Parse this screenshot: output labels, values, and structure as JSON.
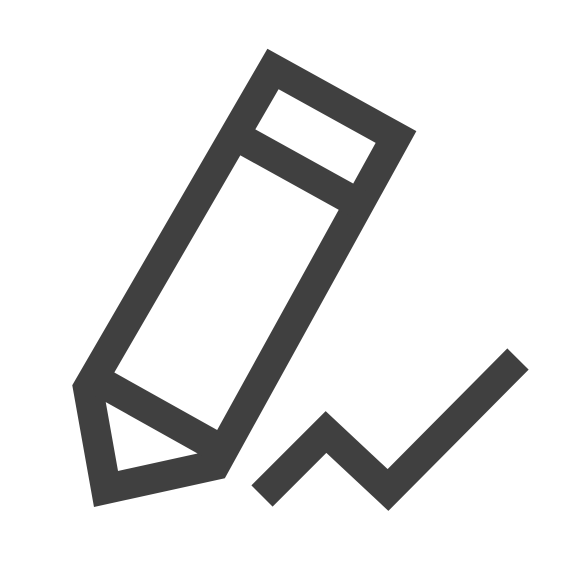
{
  "icon": {
    "name": "pencil-signature-icon",
    "color": "#404040",
    "background": "#ffffff"
  }
}
